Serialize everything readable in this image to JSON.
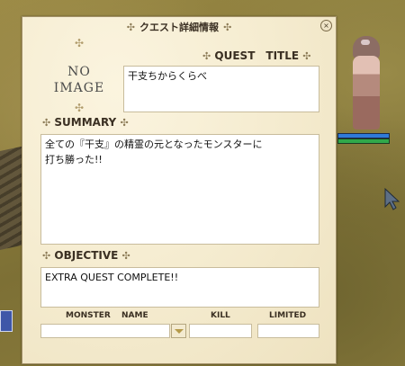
{
  "window": {
    "title": "クエスト詳細情報",
    "close_glyph": "×"
  },
  "preview": {
    "no_image_line1": "NO",
    "no_image_line2": "IMAGE"
  },
  "quest_title": {
    "label": "QUEST　TITLE",
    "value": "干支ちからくらべ"
  },
  "summary": {
    "label": "SUMMARY",
    "line1": "全ての『干支』の精霊の元となったモンスターに",
    "line2": "打ち勝った!!"
  },
  "objective": {
    "label": "OBJECTIVE",
    "value": "EXTRA QUEST COMPLETE!!"
  },
  "monster_table": {
    "col_monster": "MONSTER",
    "col_name": "NAME",
    "col_kill": "KILL",
    "col_limited": "LIMITED",
    "monster_value": "",
    "kill_value": "",
    "limited_value": ""
  },
  "icons": {
    "ornament": "✣",
    "close": "close-icon",
    "dropdown": "triangle-down-icon",
    "cursor": "cursor-arrow-icon"
  },
  "colors": {
    "window_bg": "#f5ecd0",
    "border": "#a3926a",
    "text": "#3a2f22",
    "hp": "#2f7ad9",
    "sp": "#30a84a"
  }
}
